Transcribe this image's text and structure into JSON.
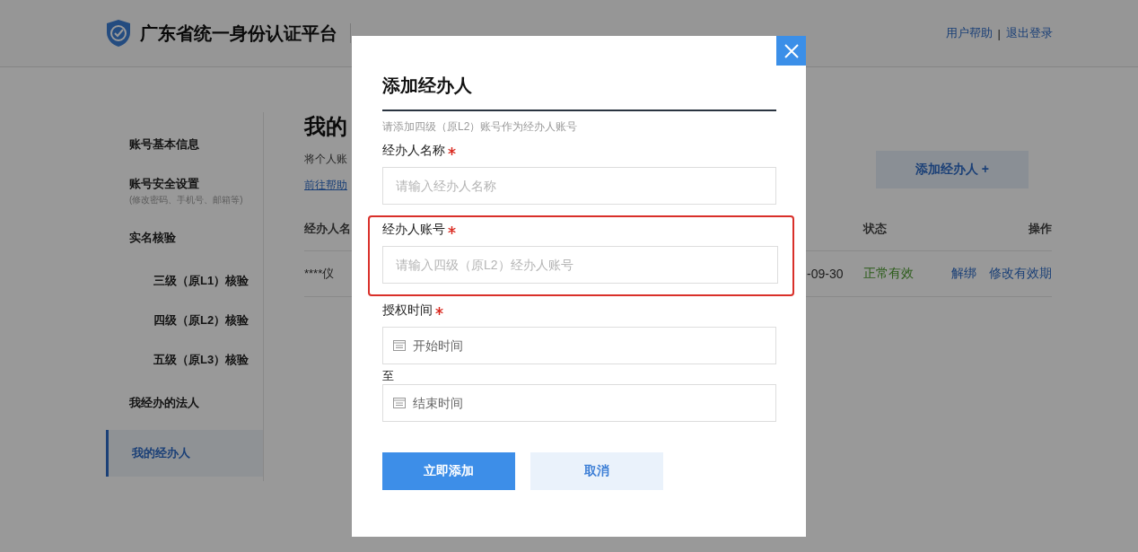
{
  "header": {
    "title": "广东省统一身份认证平台",
    "links": [
      "用户帮助",
      "退出登录"
    ],
    "separator": "|"
  },
  "sidebar": {
    "items": [
      {
        "kind": "item",
        "label": "账号基本信息",
        "selected": false
      },
      {
        "kind": "item",
        "label": "账号安全设置",
        "note": "(修改密码、手机号、邮箱等)",
        "selected": false
      },
      {
        "kind": "item",
        "label": "实名核验",
        "selected": false
      },
      {
        "kind": "sub",
        "label": "三级（原L1）核验",
        "selected": false
      },
      {
        "kind": "sub",
        "label": "四级（原L2）核验",
        "selected": false
      },
      {
        "kind": "sub",
        "label": "五级（原L3）核验",
        "selected": false
      },
      {
        "kind": "item",
        "label": "我经办的法人",
        "selected": false
      },
      {
        "kind": "item",
        "label": "我的经办人",
        "selected": true
      }
    ]
  },
  "main": {
    "title": "我的",
    "description": "将个人账",
    "help_link": "前往帮助",
    "add_button": "添加经办人 +",
    "table": {
      "columns": [
        "经办人名",
        "状态",
        "操作"
      ],
      "rows": [
        {
          "name": "****仪",
          "date": "-09-30",
          "status": "正常有效",
          "actions": [
            "解绑",
            "修改有效期"
          ]
        }
      ]
    }
  },
  "dialog": {
    "title": "添加经办人",
    "hint": "请添加四级（原L2）账号作为经办人账号",
    "fields": [
      {
        "kind": "text",
        "label": "经办人名称",
        "required": true,
        "placeholder": "请输入经办人名称",
        "highlighted": false
      },
      {
        "kind": "text",
        "label": "经办人账号",
        "required": true,
        "placeholder": "请输入四级（原L2）经办人账号",
        "highlighted": true
      },
      {
        "kind": "date-range",
        "label": "授权时间",
        "required": true,
        "start_placeholder": "开始时间",
        "separator": "至",
        "end_placeholder": "结束时间",
        "highlighted": false
      }
    ],
    "buttons": [
      {
        "label": "立即添加",
        "kind": "primary"
      },
      {
        "label": "取消",
        "kind": "secondary"
      }
    ]
  }
}
